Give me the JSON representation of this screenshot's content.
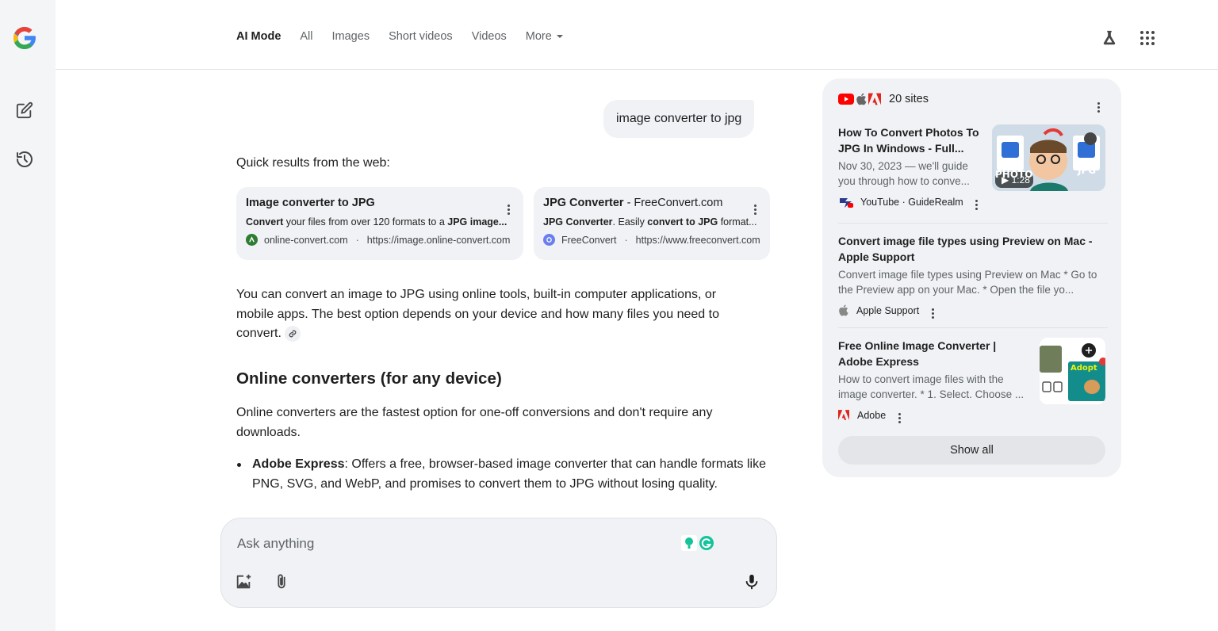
{
  "nav": {
    "tabs": [
      {
        "label": "AI Mode",
        "active": true
      },
      {
        "label": "All"
      },
      {
        "label": "Images"
      },
      {
        "label": "Short videos"
      },
      {
        "label": "Videos"
      },
      {
        "label": "More"
      }
    ]
  },
  "conversation": {
    "user_query": "image converter to jpg",
    "quick_results_heading": "Quick results from the web:",
    "quick_results": [
      {
        "title": "Image converter to JPG",
        "snippet_bold": "Convert",
        "snippet_mid": " your files from over 120 formats to a ",
        "snippet_bold2": "JPG image...",
        "site": "online-convert.com",
        "url": "https://image.online-convert.com"
      },
      {
        "title_bold": "JPG Converter",
        "title_rest": " - FreeConvert.com",
        "snippet_bold": "JPG Converter",
        "snippet_mid": ". Easily ",
        "snippet_bold2": "convert to JPG",
        "snippet_end": " format...",
        "site": "FreeConvert",
        "url": "https://www.freeconvert.com"
      }
    ],
    "intro": "You can convert an image to JPG using online tools, built-in computer applications, or mobile apps. The best option depends on your device and how many files you need to convert.",
    "section_heading": "Online converters (for any device)",
    "section_text": "Online converters are the fastest option for one-off conversions and don't require any downloads.",
    "bullet_bold": "Adobe Express",
    "bullet_text": ": Offers a free, browser-based image converter that can handle formats like PNG, SVG, and WebP, and promises to convert them to JPG without losing quality."
  },
  "askbox": {
    "placeholder": "Ask anything"
  },
  "sources_panel": {
    "count_label": "20 sites",
    "items": [
      {
        "title": "How To Convert Photos To JPG In Windows - Full...",
        "snippet": "Nov 30, 2023 — we'll guide you through how to conve...",
        "source": "YouTube · GuideRealm",
        "video_duration": "1:28",
        "thumb_text_left": "PHOTO",
        "thumb_text_right": "JPG"
      },
      {
        "title": "Convert image file types using Preview on Mac - Apple Support",
        "snippet": "Convert image file types using Preview on Mac * Go to the Preview app on your Mac. * Open the file yo...",
        "source": "Apple Support"
      },
      {
        "title": "Free Online Image Converter | Adobe Express",
        "snippet": "How to convert image files with the image converter. * 1. Select. Choose ...",
        "source": "Adobe",
        "thumb_text": "Adopt"
      }
    ],
    "show_all_label": "Show all"
  },
  "colors": {
    "google_blue": "#4285F4",
    "google_red": "#EA4335",
    "google_yellow": "#FBBC05",
    "google_green": "#34A853",
    "youtube_red": "#FF0000",
    "adobe_red": "#E1251B",
    "panel_bg": "#f0f2f5"
  }
}
